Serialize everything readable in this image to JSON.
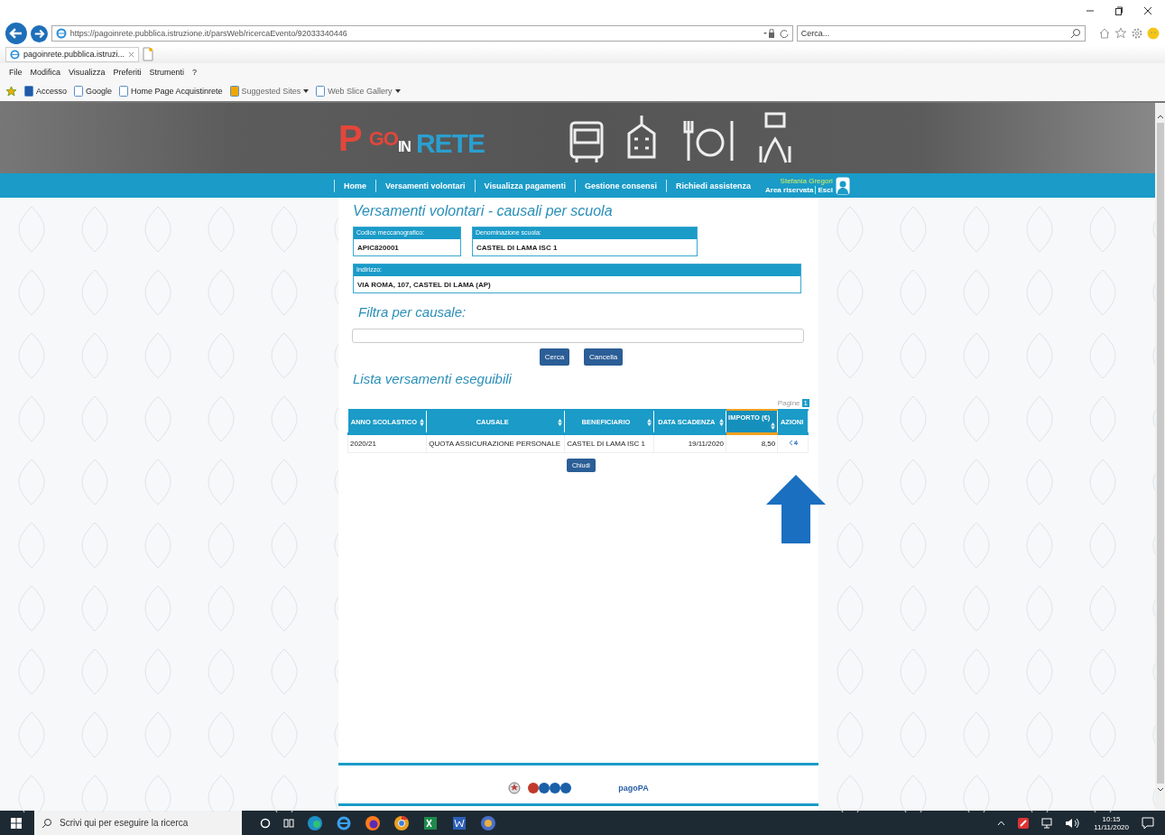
{
  "browser": {
    "url": "https://pagoinrete.pubblica.istruzione.it/parsWeb/ricercaEvento/92033340446",
    "search_placeholder": "Cerca...",
    "tab_title": "pagoinrete.pubblica.istruzi...",
    "menu": [
      "File",
      "Modifica",
      "Visualizza",
      "Preferiti",
      "Strumenti",
      "?"
    ],
    "favorites": [
      {
        "label": "Accesso",
        "kind": "plain"
      },
      {
        "label": "Google",
        "kind": "plain"
      },
      {
        "label": "Home Page Acquistinrete",
        "kind": "plain"
      },
      {
        "label": "Suggested Sites",
        "kind": "dropdown"
      },
      {
        "label": "Web Slice Gallery",
        "kind": "dropdown"
      }
    ]
  },
  "banner": {
    "logo": [
      "P",
      "GO",
      "IN",
      "RETE"
    ]
  },
  "nav": {
    "items": [
      {
        "label": "Home",
        "selected": false
      },
      {
        "label": "Versamenti volontari",
        "selected": false
      },
      {
        "label": "Visualizza pagamenti",
        "selected": false
      },
      {
        "label": "Gestione consensi",
        "selected": false
      },
      {
        "label": "Richiedi assistenza",
        "selected": false
      }
    ],
    "user_name": "Stefania Gregori",
    "links": [
      "Area riservata",
      "Esci"
    ]
  },
  "page": {
    "title": "Versamenti volontari - causali per scuola",
    "fields": [
      {
        "label": "Codice meccanografico:",
        "value": "APIC820001",
        "kind": "short"
      },
      {
        "label": "Denominazione scuola:",
        "value": "CASTEL DI LAMA ISC 1",
        "kind": "medium"
      },
      {
        "label": "Indirizzo:",
        "value": "VIA ROMA, 107, CASTEL DI LAMA (AP)",
        "kind": "wide"
      }
    ],
    "filter_title": "Filtra per causale:",
    "buttons": [
      "Cerca",
      "Cancella"
    ],
    "list_title": "Lista versamenti eseguibili",
    "pager": {
      "label": "Pagine",
      "pages": [
        {
          "label": "1",
          "selected": true
        }
      ]
    },
    "table": {
      "columns": [
        {
          "label": "ANNO SCOLASTICO",
          "sortable": true,
          "selected": false
        },
        {
          "label": "CAUSALE",
          "sortable": true,
          "selected": false
        },
        {
          "label": "BENEFICIARIO",
          "sortable": true,
          "selected": false
        },
        {
          "label": "DATA SCADENZA",
          "sortable": true,
          "selected": false
        },
        {
          "label": "IMPORTO (€)",
          "sortable": true,
          "selected": true
        },
        {
          "label": "AZIONI",
          "sortable": false,
          "selected": false
        }
      ],
      "rows": [
        [
          "2020/21",
          "QUOTA ASSICURAZIONE PERSONALE",
          "CASTEL DI LAMA ISC 1",
          "19/11/2020",
          "8,50"
        ]
      ]
    },
    "close_button": "Chiudi"
  },
  "footer": {
    "partner": "pagoPA"
  },
  "taskbar": {
    "search_placeholder": "Scrivi qui per eseguire la ricerca",
    "time": "10:15",
    "date": "11/11/2020"
  }
}
